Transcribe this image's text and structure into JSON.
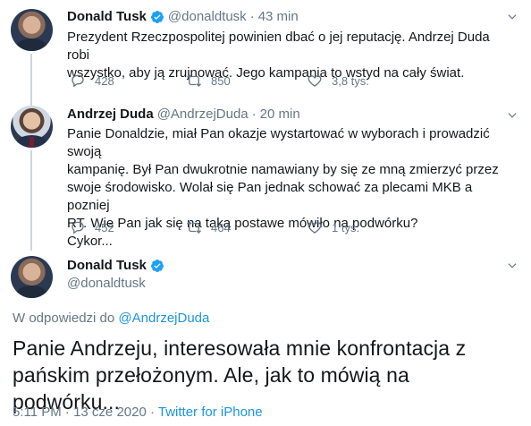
{
  "tweets": [
    {
      "name": "Donald Tusk",
      "handle": "@donaldtusk",
      "separator": "·",
      "time": "43 min",
      "text": "Prezydent Rzeczpospolitej powinien dbać o jej reputację. Andrzej Duda robi\nwszystko, aby ją zrujnować. Jego kampania to wstyd na cały świat.",
      "replies": "428",
      "retweets": "850",
      "likes": "3,8 tys."
    },
    {
      "name": "Andrzej Duda",
      "handle": "@AndrzejDuda",
      "separator": "·",
      "time": "20 min",
      "text": "Panie Donaldzie, miał Pan okazje wystartować w wyborach i prowadzić swoją\nkampanię. Był Pan dwukrotnie namawiany by się ze mną zmierzyć przez\nswoje środowisko. Wolał się Pan jednak schować za plecami MKB a pozniej\nRT. Wie Pan jak się na taką postawe mówiło na podwórku?\nCykor...",
      "replies": "452",
      "retweets": "464",
      "likes": "1 tys."
    }
  ],
  "main_tweet": {
    "name": "Donald Tusk",
    "handle": "@donaldtusk",
    "reply_prefix": "W odpowiedzi do",
    "reply_to": "@AndrzejDuda",
    "text": "Panie Andrzeju, interesowała mnie konfrontacja z\npańskim przełożonym. Ale, jak to mówią na podwórku...",
    "timestamp": "5:11 PM · 13 cze 2020 · ",
    "source": "Twitter for iPhone"
  },
  "colors": {
    "verified": "#1da1f2",
    "link": "#1b95e0",
    "secondary_text": "#657786",
    "thread_line": "#ccd6dd"
  },
  "icons": {
    "reply": "reply-icon",
    "retweet": "retweet-icon",
    "like": "heart-icon",
    "verified": "verified-badge-icon",
    "more": "chevron-down-icon"
  }
}
